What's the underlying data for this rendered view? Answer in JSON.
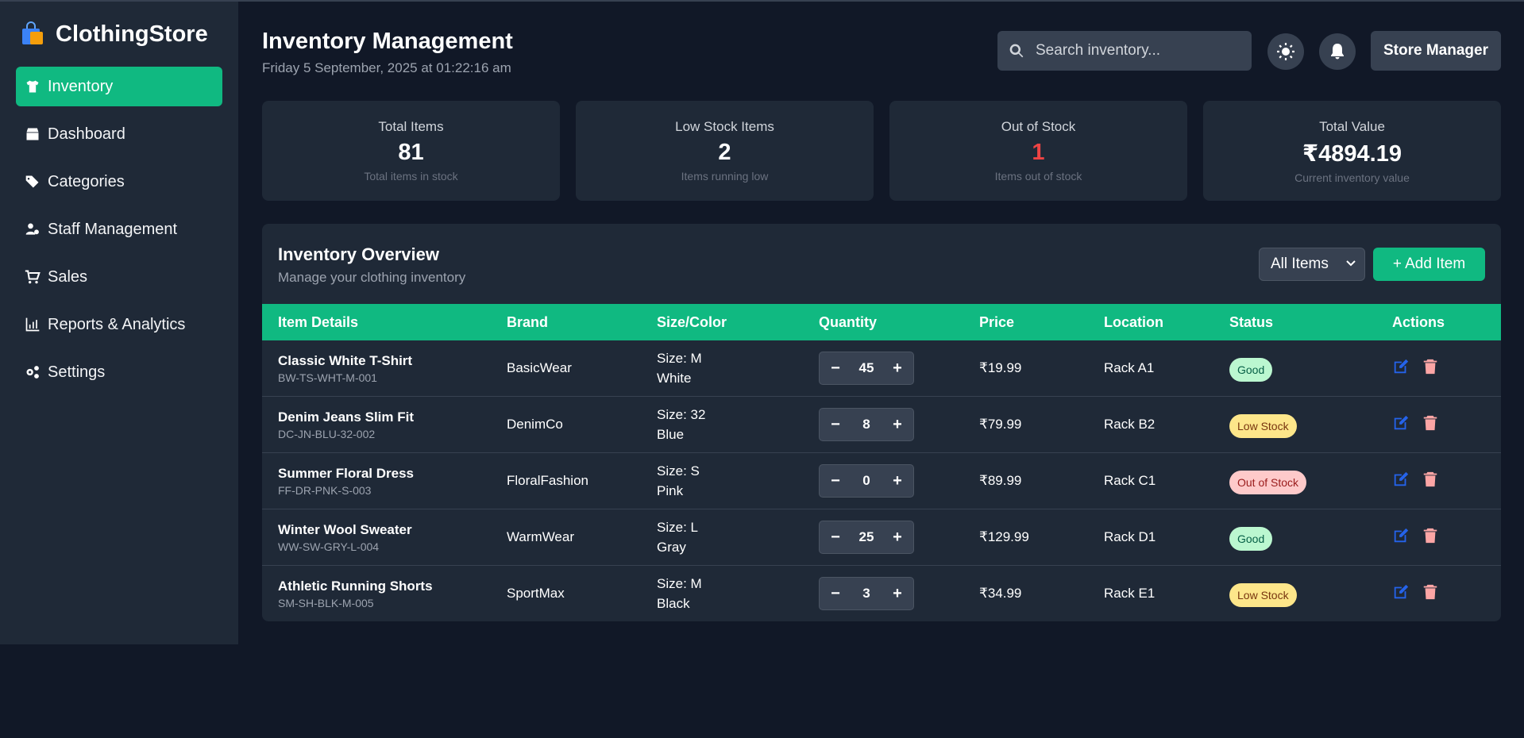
{
  "brand": {
    "name": "ClothingStore",
    "icon": "shopping-bag-icon"
  },
  "sidebar": {
    "items": [
      {
        "label": "Inventory",
        "icon": "tshirt-icon",
        "active": true
      },
      {
        "label": "Dashboard",
        "icon": "box-icon",
        "active": false
      },
      {
        "label": "Categories",
        "icon": "tags-icon",
        "active": false
      },
      {
        "label": "Staff Management",
        "icon": "user-gear-icon",
        "active": false
      },
      {
        "label": "Sales",
        "icon": "cart-icon",
        "active": false
      },
      {
        "label": "Reports & Analytics",
        "icon": "chart-icon",
        "active": false
      },
      {
        "label": "Settings",
        "icon": "gears-icon",
        "active": false
      }
    ]
  },
  "header": {
    "title": "Inventory Management",
    "date": "Friday 5 September, 2025 at 01:22:16 am",
    "search_placeholder": "Search inventory...",
    "manager_label": "Store Manager"
  },
  "stats": [
    {
      "label": "Total Items",
      "value": "81",
      "sub": "Total items in stock"
    },
    {
      "label": "Low Stock Items",
      "value": "2",
      "sub": "Items running low"
    },
    {
      "label": "Out of Stock",
      "value": "1",
      "sub": "Items out of stock"
    },
    {
      "label": "Total Value",
      "value": "₹4894.19",
      "sub": "Current inventory value"
    }
  ],
  "overview": {
    "title": "Inventory Overview",
    "subtitle": "Manage your clothing inventory",
    "filter_value": "All Items",
    "add_label": "+ Add Item"
  },
  "table": {
    "headers": [
      "Item Details",
      "Brand",
      "Size/Color",
      "Quantity",
      "Price",
      "Location",
      "Status",
      "Actions"
    ],
    "rows": [
      {
        "name": "Classic White T-Shirt",
        "sku": "BW-TS-WHT-M-001",
        "brand": "BasicWear",
        "size": "Size: M",
        "color": "White",
        "qty": "45",
        "price": "₹19.99",
        "location": "Rack A1",
        "status": "Good"
      },
      {
        "name": "Denim Jeans Slim Fit",
        "sku": "DC-JN-BLU-32-002",
        "brand": "DenimCo",
        "size": "Size: 32",
        "color": "Blue",
        "qty": "8",
        "price": "₹79.99",
        "location": "Rack B2",
        "status": "Low Stock"
      },
      {
        "name": "Summer Floral Dress",
        "sku": "FF-DR-PNK-S-003",
        "brand": "FloralFashion",
        "size": "Size: S",
        "color": "Pink",
        "qty": "0",
        "price": "₹89.99",
        "location": "Rack C1",
        "status": "Out of Stock"
      },
      {
        "name": "Winter Wool Sweater",
        "sku": "WW-SW-GRY-L-004",
        "brand": "WarmWear",
        "size": "Size: L",
        "color": "Gray",
        "qty": "25",
        "price": "₹129.99",
        "location": "Rack D1",
        "status": "Good"
      },
      {
        "name": "Athletic Running Shorts",
        "sku": "SM-SH-BLK-M-005",
        "brand": "SportMax",
        "size": "Size: M",
        "color": "Black",
        "qty": "3",
        "price": "₹34.99",
        "location": "Rack E1",
        "status": "Low Stock"
      }
    ]
  },
  "colors": {
    "accent": "#10b981",
    "bg": "#111827",
    "panel": "#1f2937",
    "danger": "#ef4444",
    "edit": "#2563eb",
    "delete": "#fca5a5"
  }
}
